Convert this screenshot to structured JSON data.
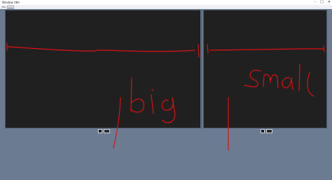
{
  "window": {
    "title": "Window title",
    "controls": [
      "–",
      "□",
      "✕"
    ]
  },
  "menubar": {
    "tab_a": "File",
    "tab_b": "Edit"
  },
  "panels": {
    "left_label": "big",
    "right_label": "small"
  },
  "colors": {
    "background": "#6b7b92",
    "panel": "#202020",
    "annotation": "#e01010"
  }
}
